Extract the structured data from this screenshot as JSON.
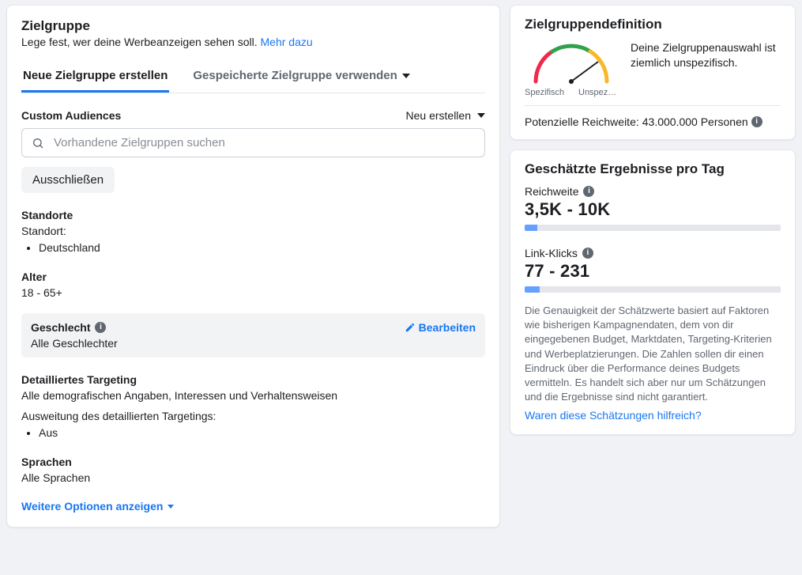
{
  "header": {
    "title": "Zielgruppe",
    "subtitle": "Lege fest, wer deine Werbeanzeigen sehen soll.",
    "learn_more": "Mehr dazu"
  },
  "tabs": {
    "create": "Neue Zielgruppe erstellen",
    "saved": "Gespeicherte Zielgruppe verwenden"
  },
  "custom_audiences": {
    "label": "Custom Audiences",
    "new": "Neu erstellen",
    "placeholder": "Vorhandene Zielgruppen suchen",
    "exclude": "Ausschließen"
  },
  "locations": {
    "label": "Standorte",
    "sub": "Standort:",
    "item": "Deutschland"
  },
  "age": {
    "label": "Alter",
    "value": "18 - 65+"
  },
  "gender": {
    "label": "Geschlecht",
    "value": "Alle Geschlechter",
    "edit": "Bearbeiten"
  },
  "detailed": {
    "label": "Detailliertes Targeting",
    "value": "Alle demografischen Angaben, Interessen und Verhaltensweisen",
    "ext_label": "Ausweitung des detaillierten Targetings:",
    "ext_value": "Aus"
  },
  "languages": {
    "label": "Sprachen",
    "value": "Alle Sprachen"
  },
  "more_options": "Weitere Optionen anzeigen",
  "definition": {
    "title": "Zielgruppendefinition",
    "spec": "Spezifisch",
    "broad": "Unspezifi…",
    "desc": "Deine Zielgruppenauswahl ist ziemlich unspezifisch.",
    "reach_label": "Potenzielle Reichweite:",
    "reach_value": "43.000.000 Personen"
  },
  "estimates": {
    "title": "Geschätzte Ergebnisse pro Tag",
    "reach_label": "Reichweite",
    "reach_value": "3,5K - 10K",
    "reach_fill": "5%",
    "clicks_label": "Link-Klicks",
    "clicks_value": "77 - 231",
    "clicks_fill": "6%",
    "footnote": "Die Genauigkeit der Schätzwerte basiert auf Faktoren wie bisherigen Kampagnendaten, dem von dir eingegebenen Budget, Marktdaten, Targeting-Kriterien und Werbeplatzierungen. Die Zahlen sollen dir einen Eindruck über die Performance deines Budgets vermitteln. Es handelt sich aber nur um Schätzungen und die Ergebnisse sind nicht garantiert.",
    "feedback": "Waren diese Schätzungen hilfreich?"
  }
}
